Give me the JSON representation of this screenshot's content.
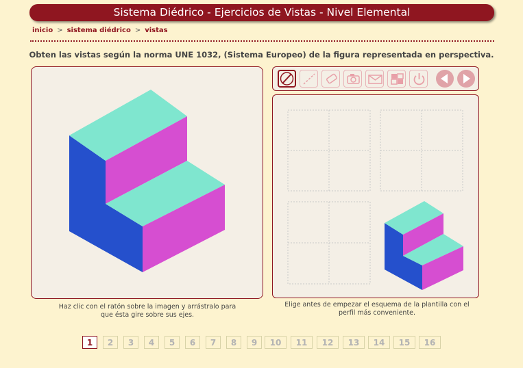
{
  "header": {
    "title": "Sistema Diédrico - Ejercicios de Vistas - Nivel Elemental"
  },
  "breadcrumb": {
    "items": [
      "inicio",
      "sistema diédrico",
      "vistas"
    ],
    "separator": ">"
  },
  "instruction": "Obten las vistas según la norma UNE 1032, (Sistema Europeo) de la figura representada en perspectiva.",
  "captions": {
    "left": "Haz clic con el ratón sobre la imagen y arrástralo para que ésta gire sobre sus ejes.",
    "right": "Elige antes de empezar el esquema de la plantilla con el perfil más conveniente."
  },
  "toolbar": {
    "icons": [
      "line-tool-icon",
      "dashed-line-tool-icon",
      "eraser-icon",
      "camera-icon",
      "email-icon",
      "layout-icon",
      "power-icon",
      "previous-icon",
      "next-icon"
    ]
  },
  "colors": {
    "accent": "#8f1620",
    "background": "#fdf3cf",
    "panel": "#f4efe6",
    "top_face": "#7fe6cf",
    "side_face": "#d64ed1",
    "front_face": "#2550cc"
  },
  "pagination": {
    "current": "1",
    "pages": [
      "1",
      "2",
      "3",
      "4",
      "5",
      "6",
      "7",
      "8",
      "9",
      "10",
      "11",
      "12",
      "13",
      "14",
      "15",
      "16"
    ]
  }
}
